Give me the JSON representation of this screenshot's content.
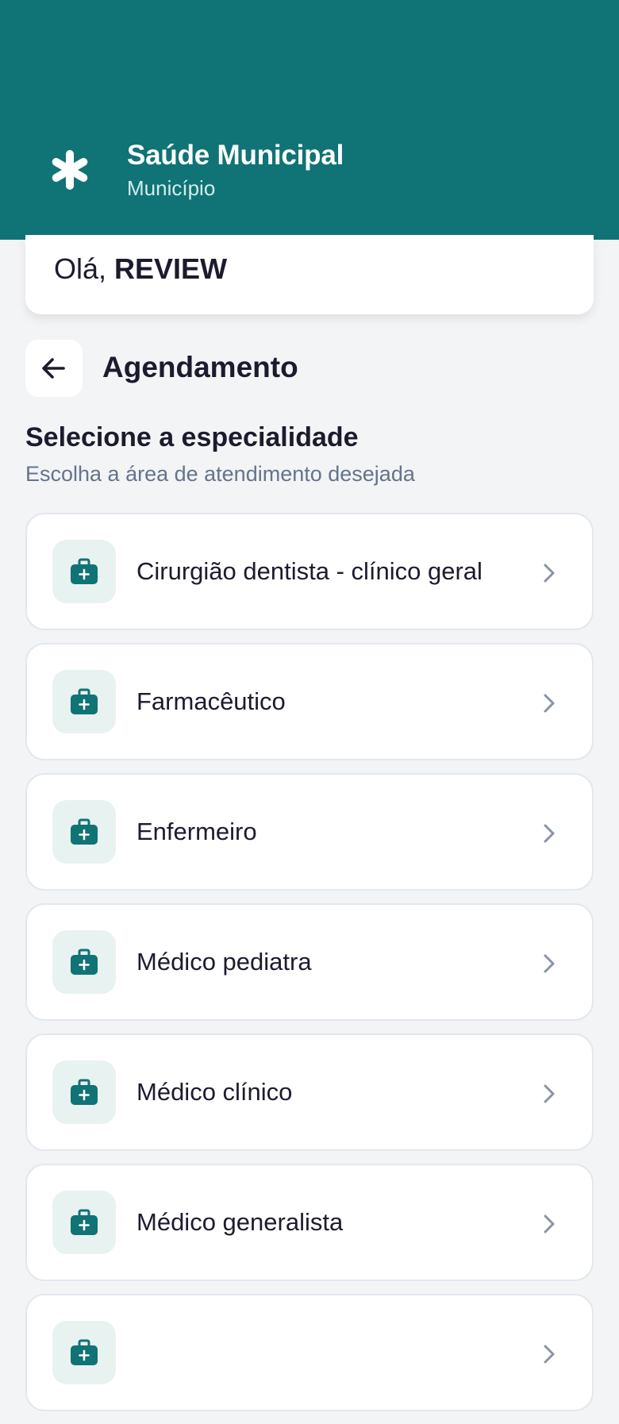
{
  "header": {
    "app_title": "Saúde Municipal",
    "app_subtitle": "Município",
    "brand_icon": "asterisk-icon",
    "background_color": "#107375"
  },
  "greeting": {
    "prefix": "Olá, ",
    "user_name": "REVIEW"
  },
  "page": {
    "back_icon": "arrow-left-icon",
    "title": "Agendamento"
  },
  "section": {
    "title": "Selecione a especialidade",
    "subtitle": "Escolha a área de atendimento desejada"
  },
  "specialties": [
    {
      "label": "Cirurgião dentista - clínico geral",
      "icon": "medical-bag-icon"
    },
    {
      "label": "Farmacêutico",
      "icon": "medical-bag-icon"
    },
    {
      "label": "Enfermeiro",
      "icon": "medical-bag-icon"
    },
    {
      "label": "Médico pediatra",
      "icon": "medical-bag-icon"
    },
    {
      "label": "Médico clínico",
      "icon": "medical-bag-icon"
    },
    {
      "label": "Médico generalista",
      "icon": "medical-bag-icon"
    },
    {
      "label": "",
      "icon": "medical-bag-icon"
    }
  ],
  "colors": {
    "accent": "#107375",
    "icon_bg": "#e8f2f1",
    "page_bg": "#f3f4f6"
  }
}
